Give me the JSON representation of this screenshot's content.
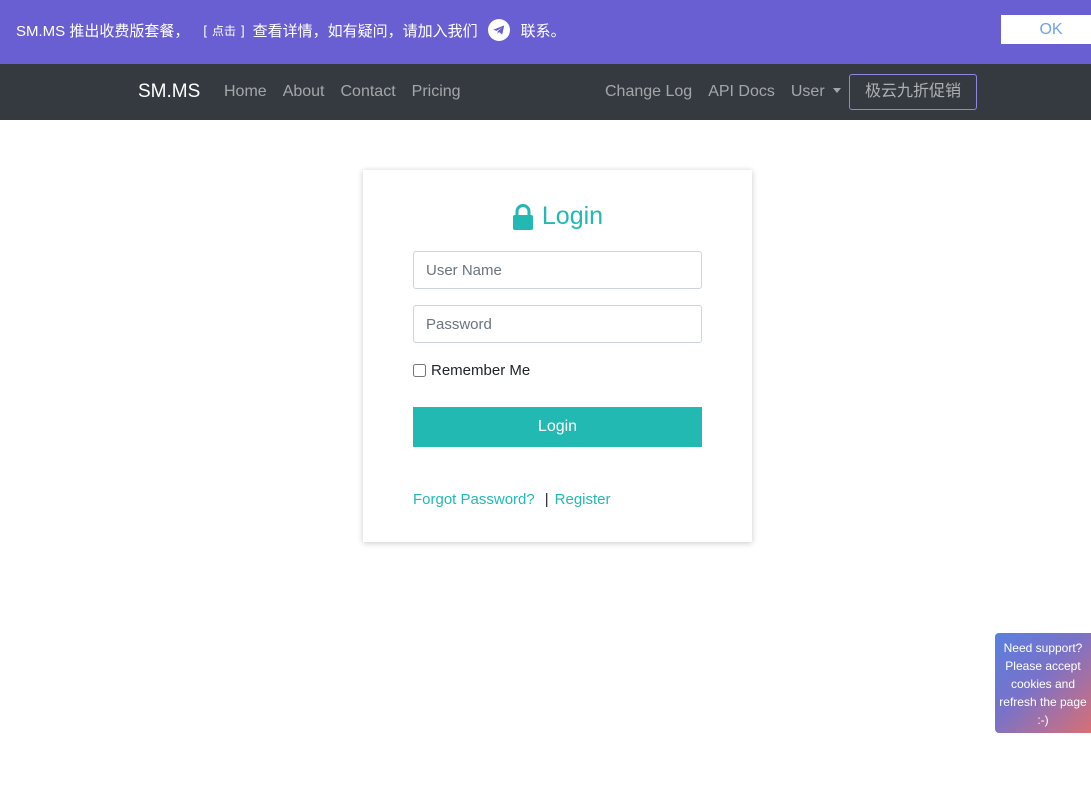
{
  "banner": {
    "text": "SM.MS 推出收费版套餐，",
    "link_bracket_open": "[",
    "link_text": "点击",
    "link_bracket_close": "]",
    "details_text": "查看详情，如有疑问，请加入我们",
    "contact_text": "联系。",
    "ok_label": "OK",
    "background_color": "#6a5fd2"
  },
  "navbar": {
    "brand": "SM.MS",
    "left_items": [
      {
        "label": "Home"
      },
      {
        "label": "About"
      },
      {
        "label": "Contact"
      },
      {
        "label": "Pricing"
      }
    ],
    "right_items": [
      {
        "label": "Change Log"
      },
      {
        "label": "API Docs"
      },
      {
        "label": "User"
      }
    ],
    "promo_label": "极云九折促销"
  },
  "login": {
    "title": "Login",
    "username_placeholder": "User Name",
    "password_placeholder": "Password",
    "remember_label": "Remember Me",
    "remember_checked": false,
    "submit_label": "Login",
    "forgot_label": "Forgot Password?",
    "separator": "|",
    "register_label": "Register",
    "accent_color": "#22b9b3"
  },
  "support": {
    "text": "Need support? Please accept cookies and refresh the page :-)"
  }
}
